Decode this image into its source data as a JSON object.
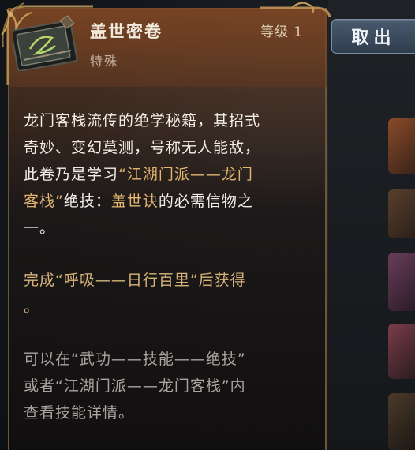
{
  "item": {
    "name": "盖世密卷",
    "level": "等级 1",
    "type": "特殊"
  },
  "description": {
    "p1": "龙门客栈流传的绝学秘籍，其招式",
    "p2": "奇妙、变幻莫测，号称无人能敌，",
    "p3a": "此卷乃是学习",
    "p3b": "“江湖门派——龙门",
    "p4a": "客栈”",
    "p4b": "绝技：",
    "p4c": "盖世诀",
    "p4d": "的必需信物之",
    "p5": "一。"
  },
  "obtain": {
    "line1": "完成“呼吸——日行百里”后获得",
    "line2": "。"
  },
  "view": {
    "line1": "可以在“武功——技能——绝技”",
    "line2": "或者“江湖门派——龙门客栈”内",
    "line3": "查看技能详情。"
  },
  "close_button": {
    "label": "取出"
  },
  "colors": {
    "highlight": "#e3b56f",
    "frame": "#6e5537",
    "button": "#3b4a5d"
  }
}
